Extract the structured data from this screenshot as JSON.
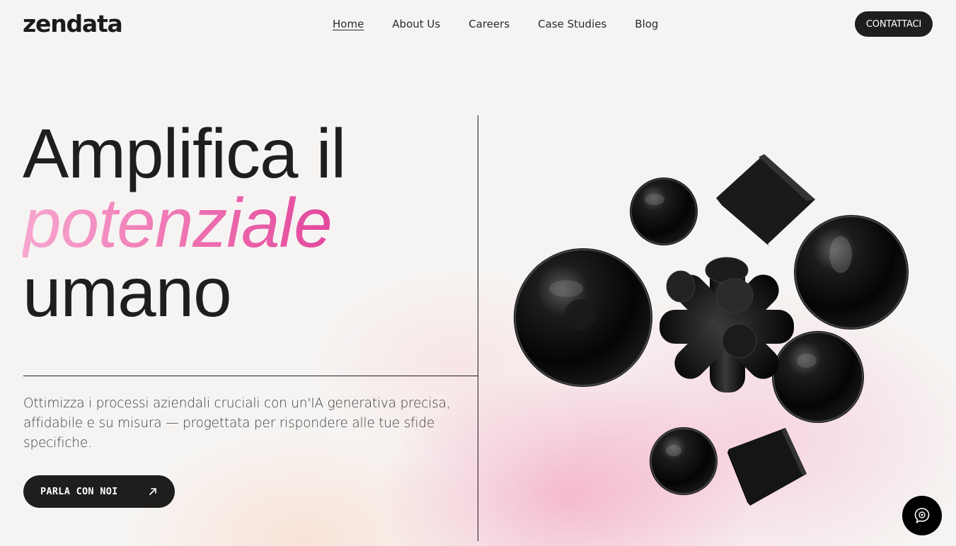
{
  "header": {
    "logo": "zendata",
    "nav": [
      "Home",
      "About Us",
      "Careers",
      "Case Studies",
      "Blog"
    ],
    "active_nav": "Home",
    "cta_label": "CONTATTACI"
  },
  "hero": {
    "title_line1": "Amplifica il",
    "title_accent": "potenziale",
    "title_line3": "umano",
    "description": "Ottimizza i processi aziendali cruciali con un'IA generativa precisa, affidabile e su misura — progettata per rispondere alle tue sfide specifiche.",
    "cta_label": "PARLA CON NOI",
    "cta_icon": "arrow-up-right-icon"
  },
  "art": {
    "description_icon": "3d-shapes-illustration",
    "accent_gradient": [
      "#f7a6cf",
      "#ee6fb0",
      "#e0449a"
    ]
  },
  "chat_widget": {
    "icon": "chat-bubble-icon"
  },
  "colors": {
    "dark": "#1e1e1e",
    "background": "#f6f4f2",
    "glow_pink": "#f48cb0"
  }
}
